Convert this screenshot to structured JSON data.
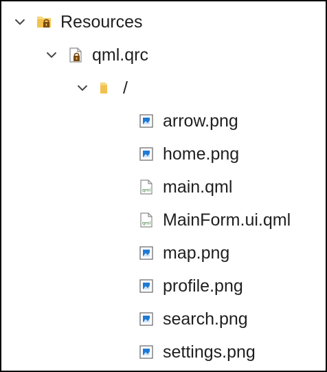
{
  "tree": {
    "root": {
      "label": "Resources",
      "icon": "folder-lock-icon",
      "expanded": true
    },
    "qrc": {
      "label": "qml.qrc",
      "icon": "file-lock-icon",
      "expanded": true
    },
    "prefix": {
      "label": "/",
      "icon": "folder-icon",
      "expanded": true
    },
    "files": [
      {
        "label": "arrow.png",
        "icon": "image-file-icon"
      },
      {
        "label": "home.png",
        "icon": "image-file-icon"
      },
      {
        "label": "main.qml",
        "icon": "qml-file-icon"
      },
      {
        "label": "MainForm.ui.qml",
        "icon": "qml-file-icon"
      },
      {
        "label": "map.png",
        "icon": "image-file-icon"
      },
      {
        "label": "profile.png",
        "icon": "image-file-icon"
      },
      {
        "label": "search.png",
        "icon": "image-file-icon"
      },
      {
        "label": "settings.png",
        "icon": "image-file-icon"
      }
    ]
  },
  "colors": {
    "folder": "#f2c24f",
    "lock": "#7a4a12",
    "image_blue": "#1f7ad3",
    "chevron": "#444444",
    "text": "#1f1f1f"
  }
}
